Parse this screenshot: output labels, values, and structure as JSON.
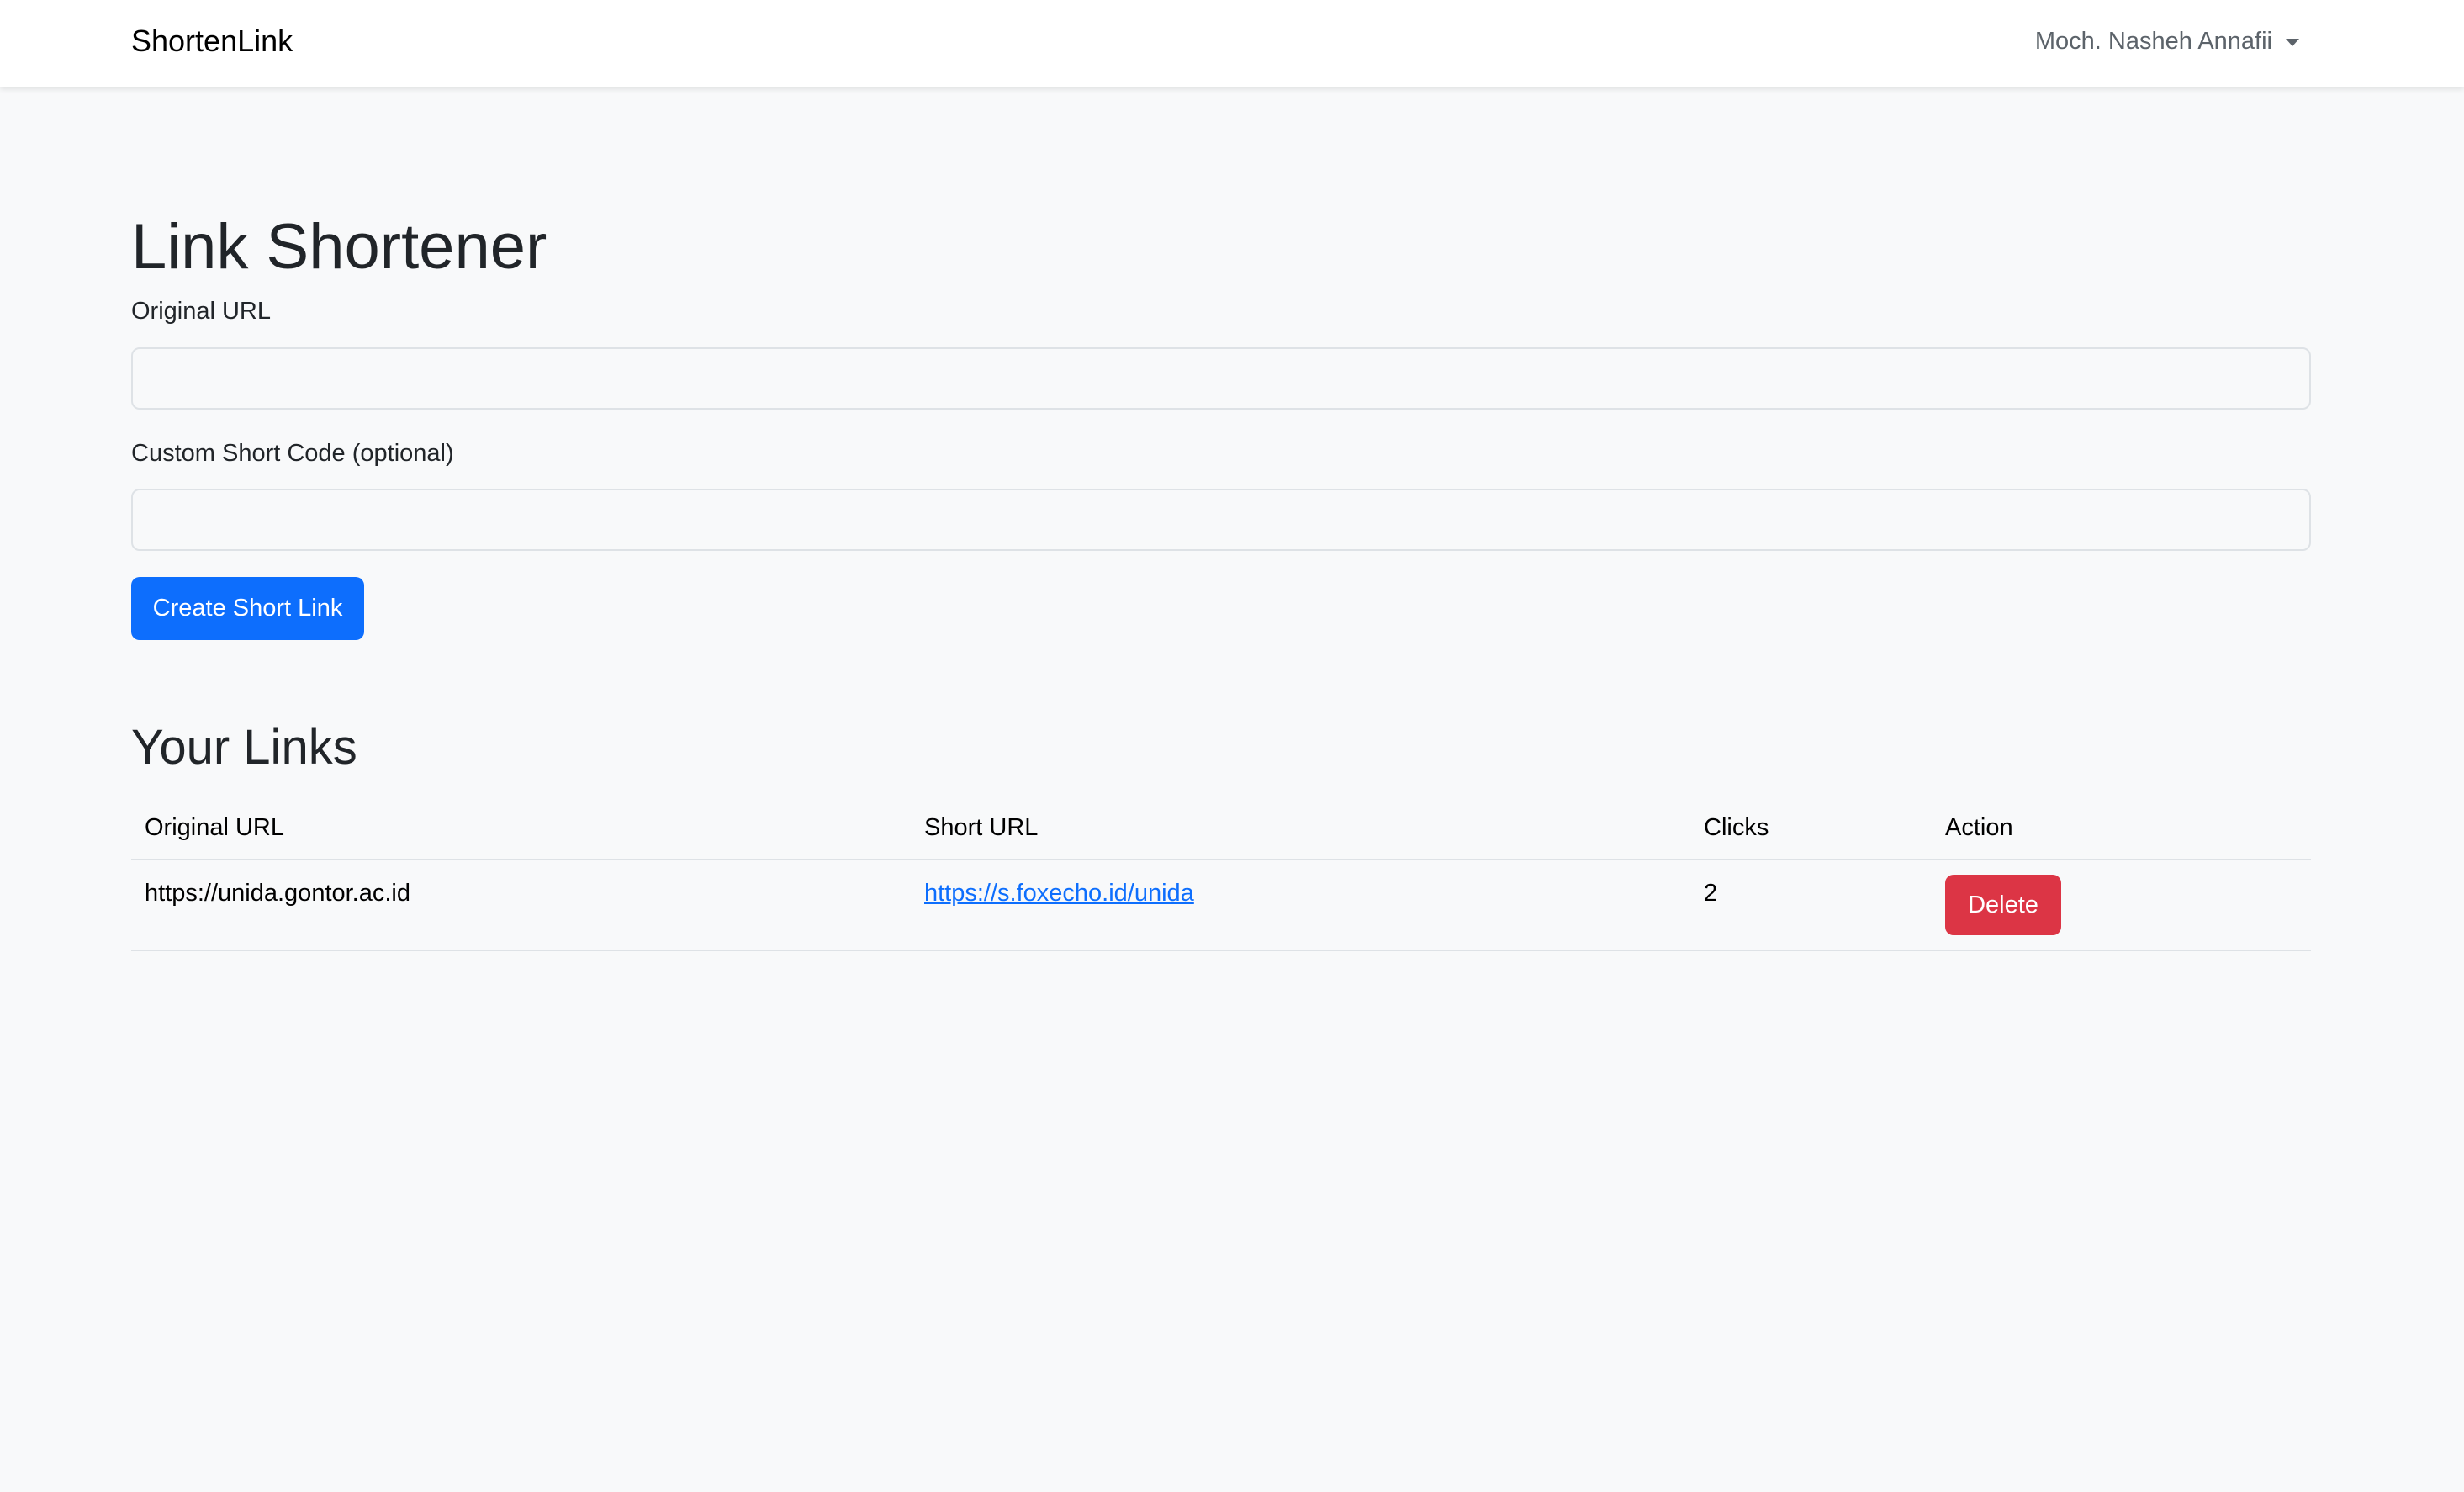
{
  "navbar": {
    "brand": "ShortenLink",
    "user_name": "Moch. Nasheh Annafii"
  },
  "main": {
    "title": "Link Shortener",
    "form": {
      "original_url_label": "Original URL",
      "original_url_value": "",
      "custom_code_label": "Custom Short Code (optional)",
      "custom_code_value": "",
      "submit_label": "Create Short Link"
    },
    "links_section": {
      "title": "Your Links",
      "columns": [
        "Original URL",
        "Short URL",
        "Clicks",
        "Action"
      ],
      "rows": [
        {
          "original_url": "https://unida.gontor.ac.id",
          "short_url": "https://s.foxecho.id/unida",
          "clicks": "2",
          "action_label": "Delete"
        }
      ]
    }
  },
  "colors": {
    "primary": "#0d6efd",
    "danger": "#dc3545",
    "background": "#f8f9fa",
    "navbar": "#ffffff"
  }
}
